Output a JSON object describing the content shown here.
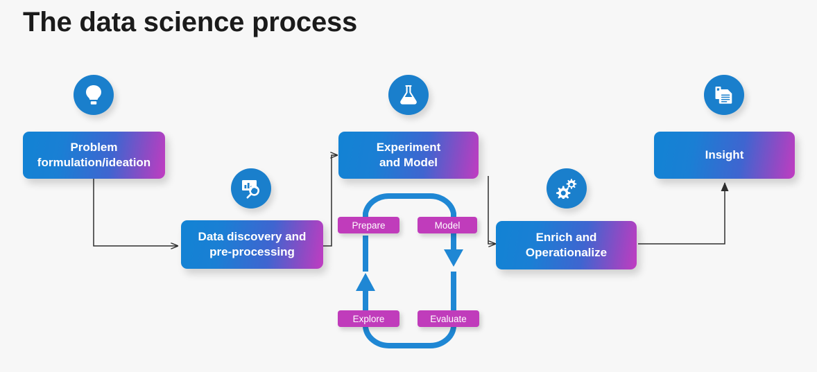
{
  "page": {
    "title": "The data science process",
    "background_color": "#f7f7f7",
    "accent_blue": "#1a7fcc",
    "accent_purple": "#c03cbb",
    "gradient_start": "#1283d4",
    "gradient_end": "#c13cc1",
    "connector_color": "#2f2f2f",
    "loop_color": "#1f87d4"
  },
  "stages": [
    {
      "id": "problem",
      "label": "Problem\nformulation/ideation",
      "line1": "Problem",
      "line2": "formulation/ideation",
      "icon": "lightbulb-icon"
    },
    {
      "id": "data-discovery",
      "label": "Data discovery and\npre-processing",
      "line1": "Data discovery and",
      "line2": "pre-processing",
      "icon": "chart-search-icon"
    },
    {
      "id": "experiment",
      "label": "Experiment\nand Model",
      "line1": "Experiment",
      "line2": "and Model",
      "icon": "flask-icon"
    },
    {
      "id": "enrich",
      "label": "Enrich and\nOperationalize",
      "line1": "Enrich and",
      "line2": "Operationalize",
      "icon": "gears-icon"
    },
    {
      "id": "insight",
      "label": "Insight",
      "line1": "Insight",
      "line2": "",
      "icon": "document-icon"
    }
  ],
  "cycle": {
    "pills": [
      {
        "id": "prepare",
        "label": "Prepare"
      },
      {
        "id": "model",
        "label": "Model"
      },
      {
        "id": "explore",
        "label": "Explore"
      },
      {
        "id": "evaluate",
        "label": "Evaluate"
      }
    ]
  },
  "chart_data": {
    "type": "diagram",
    "title": "The data science process",
    "nodes": [
      "Problem formulation/ideation",
      "Data discovery and pre-processing",
      "Experiment and Model",
      "Enrich and Operationalize",
      "Insight",
      "Prepare",
      "Model",
      "Explore",
      "Evaluate"
    ],
    "edges": [
      [
        "Problem formulation/ideation",
        "Data discovery and pre-processing"
      ],
      [
        "Data discovery and pre-processing",
        "Experiment and Model"
      ],
      [
        "Experiment and Model",
        "Enrich and Operationalize"
      ],
      [
        "Enrich and Operationalize",
        "Insight"
      ],
      [
        "Explore",
        "Prepare"
      ],
      [
        "Model",
        "Evaluate"
      ]
    ]
  }
}
